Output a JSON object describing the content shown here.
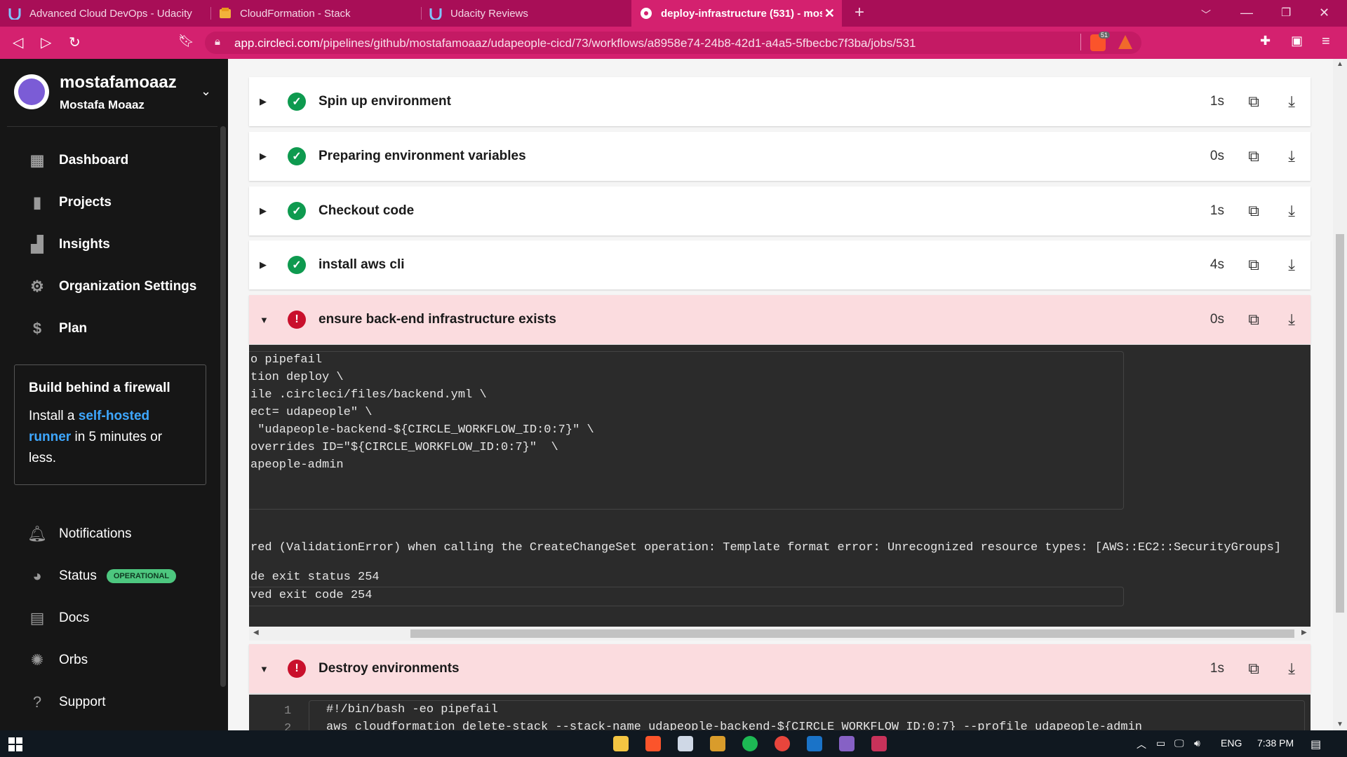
{
  "browser": {
    "tabs": [
      {
        "title": "Advanced Cloud DevOps - Udacity",
        "icon": "udacity-icon"
      },
      {
        "title": "CloudFormation - Stack",
        "icon": "aws-cloudformation-icon"
      },
      {
        "title": "Udacity Reviews",
        "icon": "udacity-icon"
      },
      {
        "title": "deploy-infrastructure (531) - most",
        "icon": "circleci-icon",
        "active": true
      }
    ],
    "url_host": "app.circleci.com",
    "url_path": "/pipelines/github/mostafamoaaz/udapeople-cicd/73/workflows/a8958e74-24b8-42d1-a4a5-5fbecbc7f3ba/jobs/531",
    "brave_badge": "51",
    "colors": {
      "accent": "#d4216f",
      "tabstrip": "#a80e57"
    }
  },
  "sidebar": {
    "username": "mostafamoaaz",
    "full_name": "Mostafa Moaaz",
    "nav": [
      {
        "label": "Dashboard",
        "icon": "dashboard-icon"
      },
      {
        "label": "Projects",
        "icon": "projects-icon"
      },
      {
        "label": "Insights",
        "icon": "insights-icon"
      },
      {
        "label": "Organization Settings",
        "icon": "gear-icon"
      },
      {
        "label": "Plan",
        "icon": "dollar-icon"
      }
    ],
    "promo": {
      "title": "Build behind a firewall",
      "body_pre": "Install a ",
      "link": "self-hosted runner",
      "body_post": " in 5 minutes or less."
    },
    "bottom_nav": [
      {
        "label": "Notifications",
        "icon": "bell-icon"
      },
      {
        "label": "Status",
        "icon": "status-icon",
        "badge": "OPERATIONAL"
      },
      {
        "label": "Docs",
        "icon": "docs-icon"
      },
      {
        "label": "Orbs",
        "icon": "orbs-icon"
      },
      {
        "label": "Support",
        "icon": "help-icon"
      }
    ]
  },
  "steps": [
    {
      "name": "Spin up environment",
      "duration": "1s",
      "status": "success"
    },
    {
      "name": "Preparing environment variables",
      "duration": "0s",
      "status": "success"
    },
    {
      "name": "Checkout code",
      "duration": "1s",
      "status": "success"
    },
    {
      "name": "install aws cli",
      "duration": "4s",
      "status": "success"
    },
    {
      "name": "ensure back-end infrastructure exists",
      "duration": "0s",
      "status": "failed"
    },
    {
      "name": "Destroy environments",
      "duration": "1s",
      "status": "failed"
    }
  ],
  "terminal": {
    "command_lines": [
      "o pipefail",
      "tion deploy \\",
      "ile .circleci/files/backend.yml \\",
      "ect= udapeople\" \\",
      " \"udapeople-backend-${CIRCLE_WORKFLOW_ID:0:7}\" \\",
      "overrides ID=\"${CIRCLE_WORKFLOW_ID:0:7}\"  \\",
      "apeople-admin"
    ],
    "error_line": "red (ValidationError) when calling the CreateChangeSet operation: Template format error: Unrecognized resource types: [AWS::EC2::SecurityGroups]",
    "exit_status": "de exit status 254",
    "exit_code": "ved exit code 254"
  },
  "terminal2": {
    "lines": [
      {
        "no": "1",
        "text": "#!/bin/bash -eo pipefail"
      },
      {
        "no": "2",
        "text": "aws cloudformation delete-stack --stack-name udapeople-backend-${CIRCLE_WORKFLOW_ID:0:7} --profile udapeople-admin"
      }
    ]
  },
  "taskbar": {
    "language": "ENG",
    "time": "7:38 PM"
  }
}
